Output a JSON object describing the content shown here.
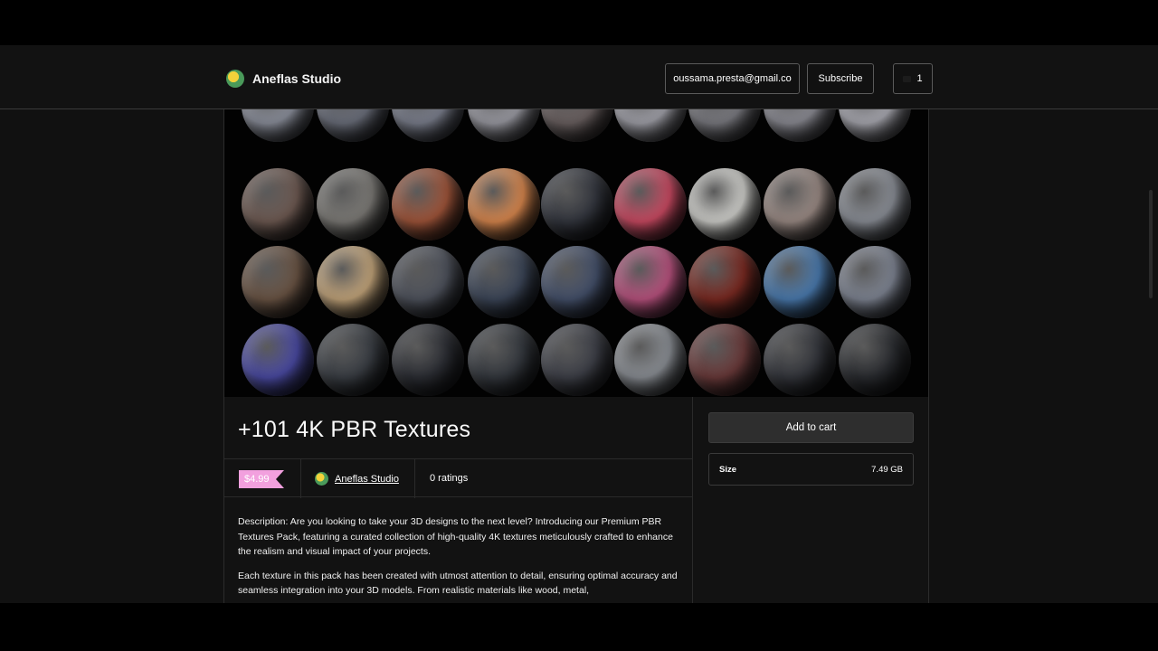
{
  "header": {
    "brand": "Aneflas Studio",
    "email": "oussama.presta@gmail.co",
    "subscribe_label": "Subscribe",
    "cart_count": "1"
  },
  "product": {
    "title": "+101 4K PBR Textures",
    "price": "$4.99",
    "creator": "Aneflas Studio",
    "ratings": "0 ratings",
    "add_to_cart_label": "Add to cart",
    "size_label": "Size",
    "size_value": "7.49 GB",
    "description_1": "Description: Are you looking to take your 3D designs to the next level? Introducing our Premium PBR Textures Pack, featuring a curated collection of high-quality 4K textures meticulously crafted to enhance the realism and visual impact of your projects.",
    "description_2": "Each texture in this pack has been created with utmost attention to detail, ensuring optimal accuracy and seamless integration into your 3D models. From realistic materials like wood, metal,"
  },
  "colors": {
    "price_tag": "#f2a0de",
    "background": "#121212",
    "border": "#2a2a2a"
  }
}
